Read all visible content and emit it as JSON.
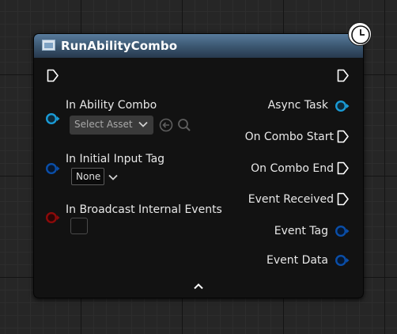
{
  "node": {
    "title": "RunAbilityCombo",
    "inputs": [
      {
        "label": "In Ability Combo",
        "widget_value": "Select Asset"
      },
      {
        "label": "In Initial Input Tag",
        "widget_value": "None"
      },
      {
        "label": "In Broadcast Internal Events",
        "checked": false
      }
    ],
    "outputs": [
      {
        "label": "Async Task"
      },
      {
        "label": "On Combo Start"
      },
      {
        "label": "On Combo End"
      },
      {
        "label": "Event Received"
      },
      {
        "label": "Event Tag"
      },
      {
        "label": "Event Data"
      }
    ]
  },
  "icons": {
    "header": "function-icon",
    "latent": "clock-icon",
    "exec": "exec-pin-icon",
    "data_pin": "data-pin-icon",
    "asset_use": "use-selected-asset-icon",
    "asset_browse": "browse-asset-icon",
    "dropdown": "chevron-down-icon",
    "collapse": "chevron-up-icon"
  },
  "colors": {
    "header_top": "#587b9c",
    "header_bottom": "#27394d",
    "body": "#121212",
    "object_pin": "#1a9bd6",
    "tag_pin": "#0a4ea8",
    "bool_pin": "#8c0a0a",
    "exec_pin": "#ffffff"
  }
}
